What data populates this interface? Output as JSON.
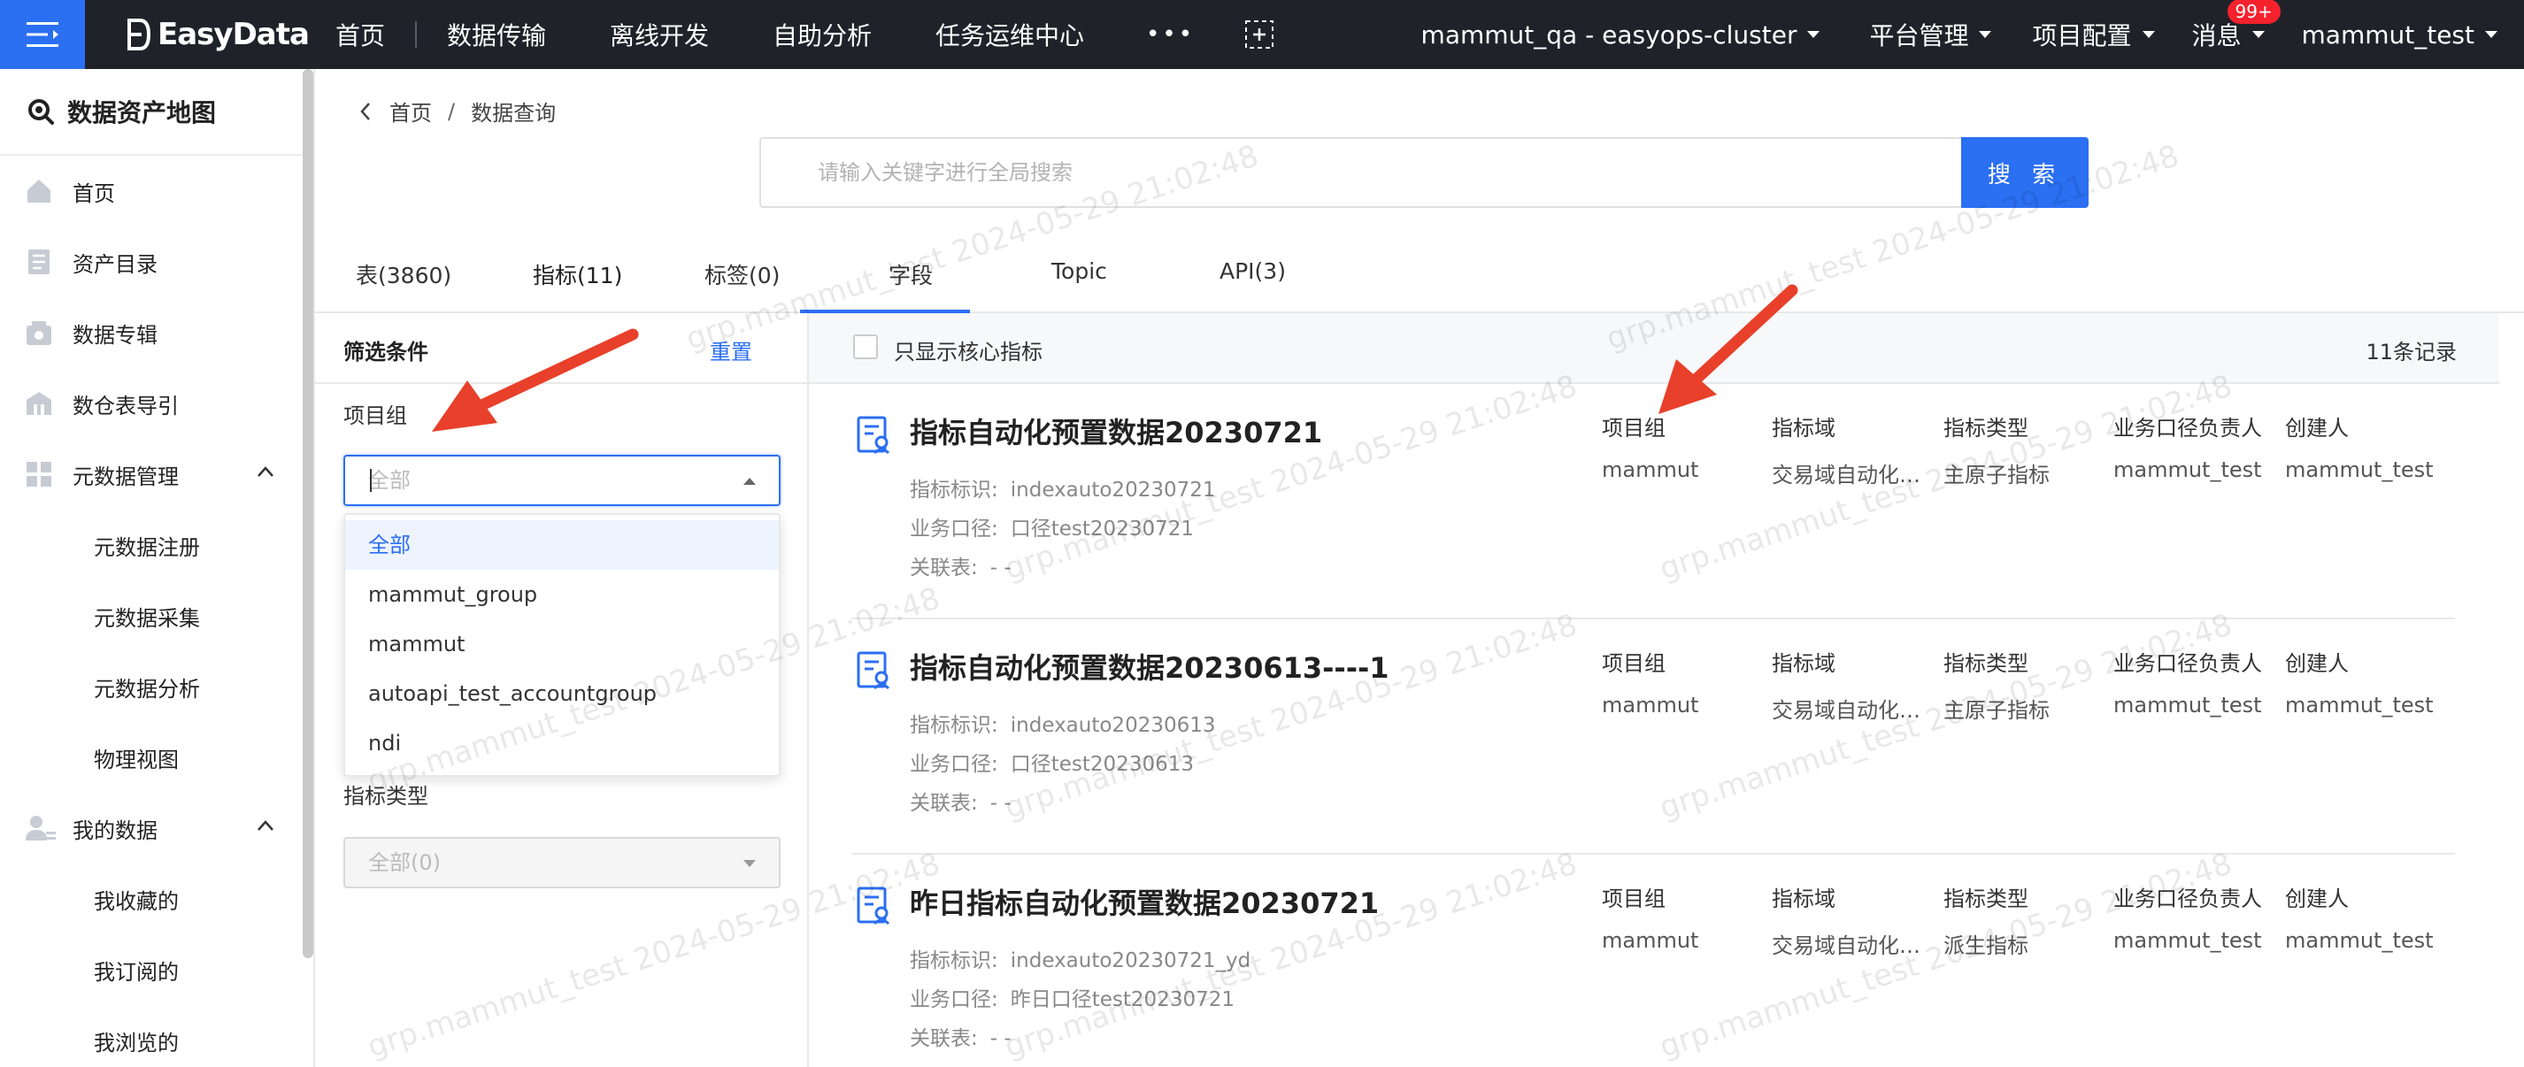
{
  "app": {
    "logo": "EasyData",
    "nav": [
      "首页",
      "数据传输",
      "离线开发",
      "自助分析",
      "任务运维中心"
    ],
    "more": "•••",
    "cluster": "mammut_qa - easyops-cluster",
    "platform": "平台管理",
    "project": "项目配置",
    "messages": "消息",
    "badge": "99+",
    "user": "mammut_test"
  },
  "sidebar": {
    "title": "数据资产地图",
    "items": [
      {
        "label": "首页",
        "icon": "home-icon"
      },
      {
        "label": "资产目录",
        "icon": "catalog-icon"
      },
      {
        "label": "数据专辑",
        "icon": "album-icon"
      },
      {
        "label": "数仓表导引",
        "icon": "warehouse-icon"
      },
      {
        "label": "元数据管理",
        "icon": "grid-icon"
      },
      {
        "label": "元数据注册"
      },
      {
        "label": "元数据采集"
      },
      {
        "label": "元数据分析"
      },
      {
        "label": "物理视图"
      },
      {
        "label": "我的数据",
        "icon": "user-data-icon"
      },
      {
        "label": "我收藏的"
      },
      {
        "label": "我订阅的"
      },
      {
        "label": "我浏览的"
      }
    ]
  },
  "breadcrumb": {
    "home": "首页",
    "sep": "/",
    "current": "数据查询"
  },
  "search": {
    "placeholder": "请输入关键字进行全局搜索",
    "button": "搜 索"
  },
  "tabs": [
    "表(3860)",
    "指标(11)",
    "标签(0)",
    "字段",
    "Topic",
    "API(3)"
  ],
  "filter": {
    "title": "筛选条件",
    "reset": "重置",
    "project_label": "项目组",
    "project_placeholder": "全部",
    "options": [
      "全部",
      "mammut_group",
      "mammut",
      "autoapi_test_accountgroup",
      "ndi"
    ],
    "type_label": "指标类型",
    "type_value": "全部(0)"
  },
  "results": {
    "core_only": "只显示核心指标",
    "count": "11条记录",
    "col_headers": [
      "项目组",
      "指标域",
      "指标类型",
      "业务口径负责人",
      "创建人"
    ],
    "label_id": "指标标识:",
    "label_biz": "业务口径:",
    "label_rel": "关联表:",
    "items": [
      {
        "title": "指标自动化预置数据20230721",
        "id": "indexauto20230721",
        "biz": "口径test20230721",
        "rel": "- -",
        "cols": [
          "mammut",
          "交易域自动化创…",
          "主原子指标",
          "mammut_test",
          "mammut_test"
        ]
      },
      {
        "title": "指标自动化预置数据20230613----1",
        "id": "indexauto20230613",
        "biz": "口径test20230613",
        "rel": "- -",
        "cols": [
          "mammut",
          "交易域自动化创…",
          "主原子指标",
          "mammut_test",
          "mammut_test"
        ]
      },
      {
        "title": "昨日指标自动化预置数据20230721",
        "id": "indexauto20230721_yd",
        "biz": "昨日口径test20230721",
        "rel": "- -",
        "cols": [
          "mammut",
          "交易域自动化创…",
          "派生指标",
          "mammut_test",
          "mammut_test"
        ]
      }
    ]
  },
  "watermark": "grp.mammut_test 2024-05-29 21:02:48",
  "colors": {
    "accent": "#2b6ff2",
    "topbar": "#1f2329",
    "arrow": "#e8402a",
    "badge": "#f5222d"
  }
}
